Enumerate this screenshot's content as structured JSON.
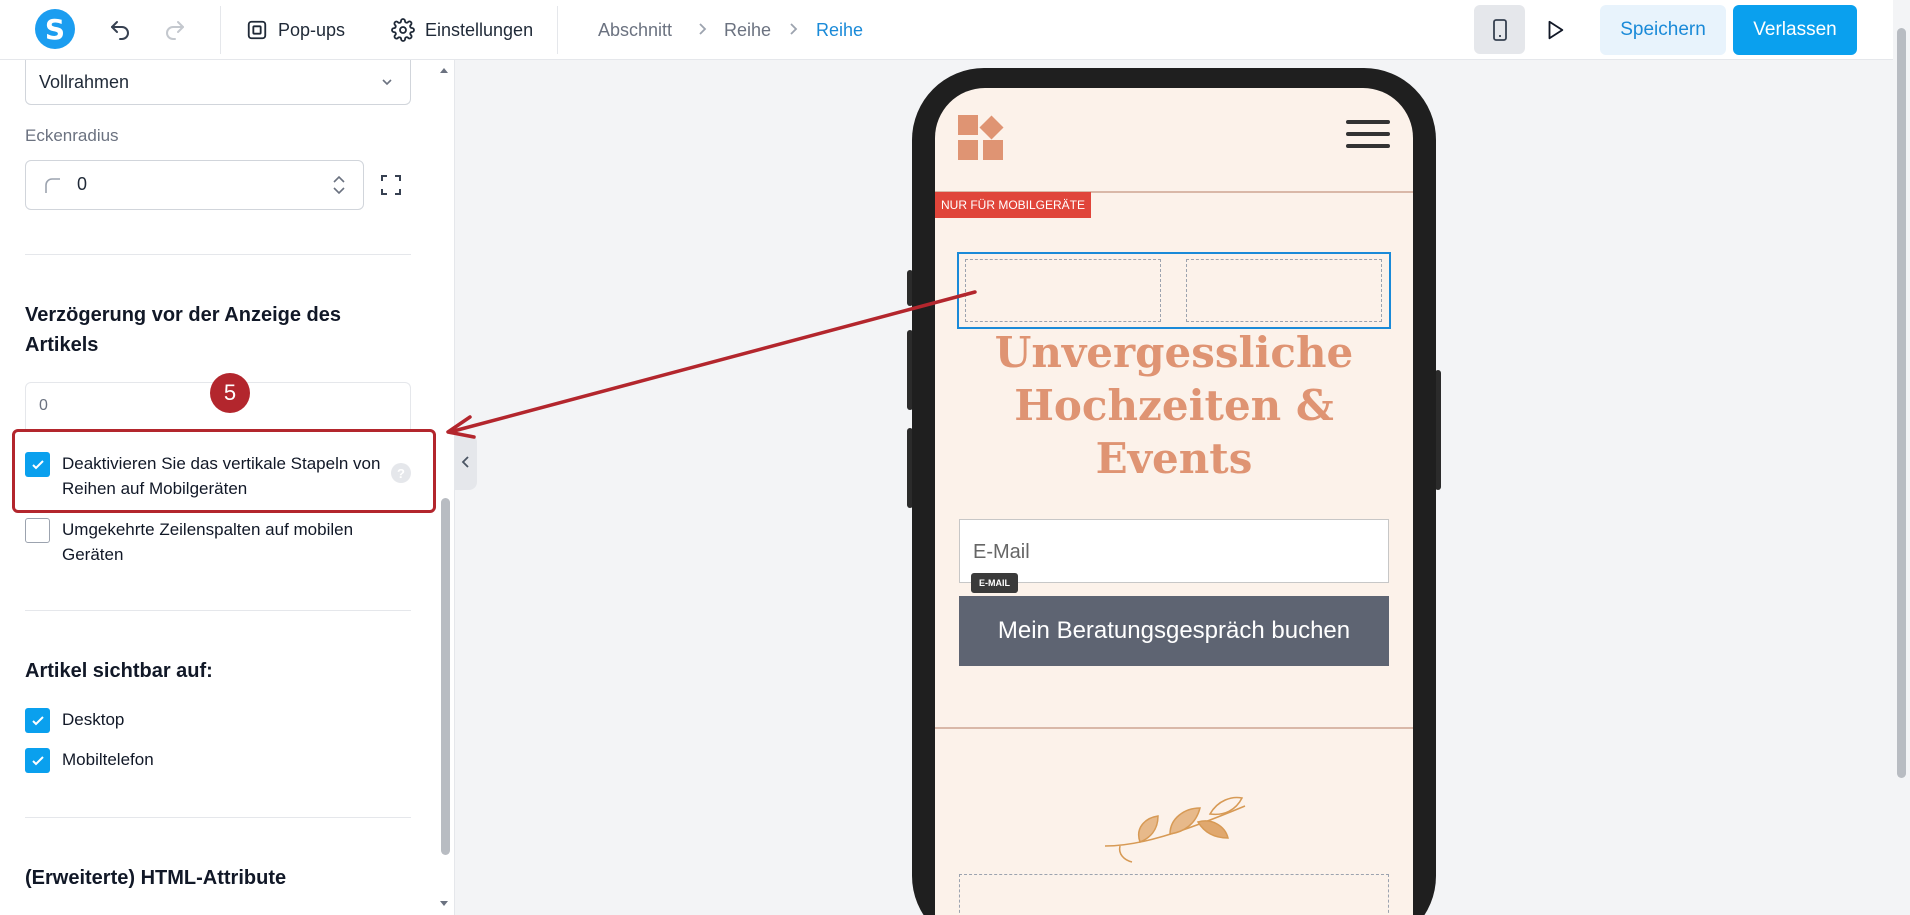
{
  "toolbar": {
    "logo_letter": "S",
    "popups_label": "Pop-ups",
    "settings_label": "Einstellungen",
    "breadcrumb": [
      "Abschnitt",
      "Reihe",
      "Reihe"
    ],
    "save_label": "Speichern",
    "leave_label": "Verlassen"
  },
  "panel": {
    "frame_select_value": "Vollrahmen",
    "corner_radius_label": "Eckenradius",
    "corner_radius_value": "0",
    "delay_title": "Verzögerung vor der Anzeige des Artikels",
    "delay_value": "0",
    "disable_stacking_label": "Deaktivieren Sie das vertikale Stapeln von Reihen auf Mobilgeräten",
    "disable_stacking_checked": true,
    "reverse_columns_label": "Umgekehrte Zeilenspalten auf mobilen Geräten",
    "reverse_columns_checked": false,
    "visible_on_title": "Artikel sichtbar auf:",
    "visible_desktop_label": "Desktop",
    "visible_mobile_label": "Mobiltelefon",
    "html_attributes_title": "(Erweiterte) HTML-Attribute",
    "help_glyph": "?"
  },
  "annotation": {
    "step_number": "5",
    "color": "#b3262d"
  },
  "preview": {
    "mobile_only_tag": "NUR FÜR MOBILGERÄTE",
    "headline": "Unvergessliche Hochzeiten & Events",
    "email_placeholder": "E-Mail",
    "email_tag": "E-MAIL",
    "cta_label": "Mein Beratungsgespräch buchen",
    "headline_color": "#df9473",
    "accent_color": "#0aa0ee"
  }
}
